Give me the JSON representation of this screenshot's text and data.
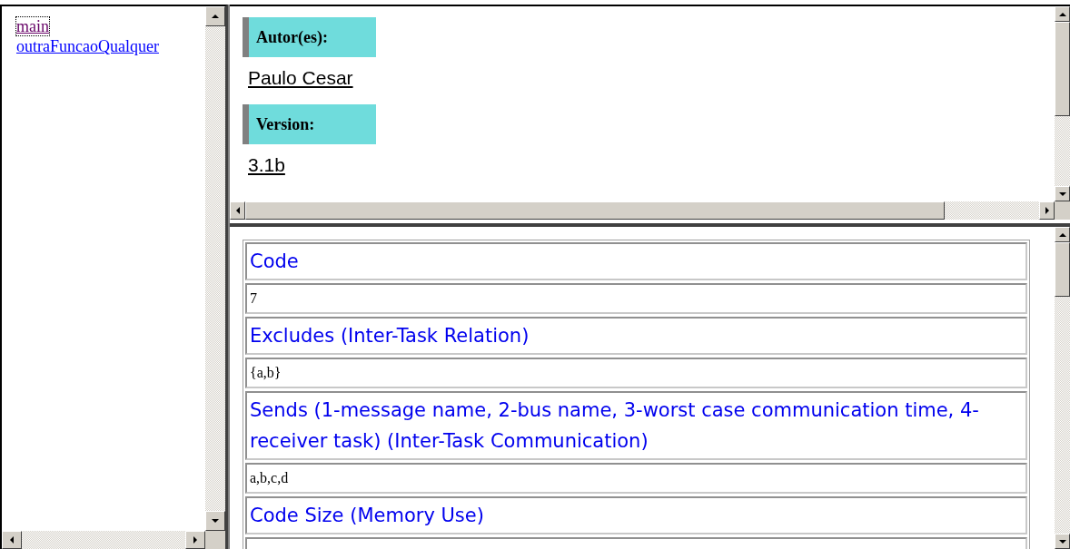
{
  "nav_frame": {
    "links": [
      {
        "label": "main",
        "selected": true
      },
      {
        "label": "outraFuncaoQualquer",
        "selected": false
      }
    ]
  },
  "info_frame": {
    "sections": [
      {
        "heading": "Autor(es):",
        "value": "Paulo Cesar"
      },
      {
        "heading": "Version:",
        "value": "3.1b"
      }
    ]
  },
  "detail_frame": {
    "rows": [
      {
        "kind": "heading",
        "text": "Code"
      },
      {
        "kind": "value",
        "text": "7"
      },
      {
        "kind": "heading",
        "text": "Excludes (Inter-Task Relation)"
      },
      {
        "kind": "value",
        "text": "{a,b}"
      },
      {
        "kind": "heading",
        "text": "Sends (1-message name, 2-bus name, 3-worst case communication time, 4-receiver task) (Inter-Task Communication)"
      },
      {
        "kind": "value",
        "text": "a,b,c,d"
      },
      {
        "kind": "heading",
        "text": "Code Size (Memory Use)"
      },
      {
        "kind": "value",
        "text": ""
      }
    ]
  }
}
